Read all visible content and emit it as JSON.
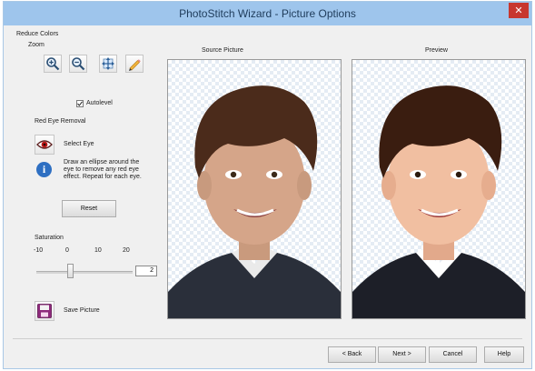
{
  "window": {
    "title": "PhotoStitch Wizard - Picture Options",
    "close_glyph": "✕"
  },
  "group_label": "Reduce Colors",
  "zoom": {
    "label": "Zoom",
    "icons": [
      "zoom-in-icon",
      "zoom-out-icon",
      "move-icon",
      "pencil-icon"
    ]
  },
  "autolevel": {
    "label": "Autolevel",
    "checked": true
  },
  "red_eye": {
    "label": "Red Eye Removal",
    "select_label": "Select Eye",
    "info_line1": "Draw an ellipse around the",
    "info_line2": "eye to remove any red eye",
    "info_line3": "effect. Repeat for each eye.",
    "reset_label": "Reset"
  },
  "saturation": {
    "label": "Saturation",
    "ticks": [
      "-10",
      "0",
      "10",
      "20"
    ],
    "value": "2"
  },
  "save": {
    "label": "Save Picture"
  },
  "source": {
    "title": "Source Picture"
  },
  "preview": {
    "title": "Preview"
  },
  "footer": {
    "back": "< Back",
    "next": "Next >",
    "cancel": "Cancel",
    "help": "Help"
  }
}
